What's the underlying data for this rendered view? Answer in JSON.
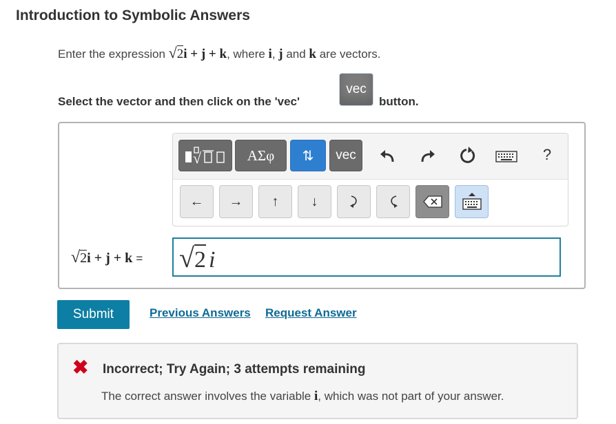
{
  "title": "Introduction to Symbolic Answers",
  "instruction": {
    "prefix": "Enter the expression ",
    "expr_radicand": "2",
    "expr_rest": "i + j + k",
    "middle": ", where ",
    "v1": "i",
    "sep": ", ",
    "v2": "j",
    "and": " and ",
    "v3": "k",
    "suffix": " are vectors."
  },
  "select_instruction": {
    "before": "Select the vector and then click on the 'vec'",
    "after": "button.",
    "vec_label": "vec"
  },
  "toolbar": {
    "templates_label": "templates",
    "greek_label": "ΑΣφ",
    "arrows_label": "⇅",
    "vec_label": "vec",
    "help_label": "?",
    "nav": [
      "←",
      "→",
      "↑",
      "↓"
    ]
  },
  "answer": {
    "label_radicand": "2",
    "label_rest": "i + j + k",
    "equals": "=",
    "input_radicand": "2",
    "input_rest": "i"
  },
  "actions": {
    "submit_label": "Submit",
    "previous_answers": "Previous Answers",
    "request_answer": "Request Answer"
  },
  "feedback": {
    "icon": "✖",
    "title": "Incorrect; Try Again; 3 attempts remaining",
    "message_before": "The correct answer involves the variable ",
    "variable": "i",
    "message_after": ", which was not part of your answer."
  },
  "colors": {
    "accent": "#0d7ea4",
    "error": "#d0021b",
    "toolbar_dark": "#6b6b6b",
    "toolbar_blue": "#2f7fd1"
  },
  "icons": {
    "undo": "undo-icon",
    "redo": "redo-icon",
    "reset": "reset-icon",
    "keyboard": "keyboard-icon",
    "backspace": "backspace-icon",
    "keyboard_toggle": "keyboard-toggle-icon"
  }
}
